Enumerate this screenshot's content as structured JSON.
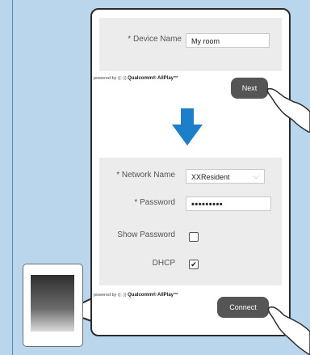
{
  "step1": {
    "device_name_label": "* Device Name",
    "device_name_value": "My room",
    "powered_by": "powered by",
    "brand": "Qualcomm® AllPlay™",
    "next_label": "Next"
  },
  "step2": {
    "network_name_label": "* Network Name",
    "network_name_value": "XXResident",
    "password_label": "* Password",
    "password_value": "•••••••••",
    "show_password_label": "Show Password",
    "show_password_checked": false,
    "dhcp_label": "DHCP",
    "dhcp_checked": true,
    "powered_by": "powered by",
    "brand": "Qualcomm® AllPlay™",
    "connect_label": "Connect"
  },
  "icons": {
    "arrow": "down-arrow-icon",
    "check": "checkmark-icon",
    "dropdown": "chevron-down-icon",
    "hand": "pointing-hand-icon",
    "phone": "smartphone-icon"
  },
  "colors": {
    "background": "#b9d6ec",
    "arrow": "#1c7fc9",
    "button": "#555555",
    "panel": "#ececec"
  }
}
